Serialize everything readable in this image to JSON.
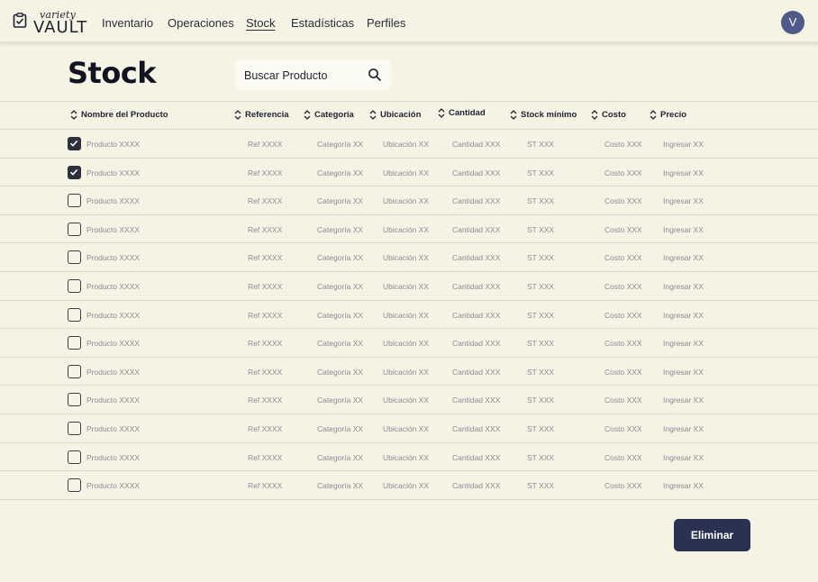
{
  "brand": {
    "small": "variety",
    "big": "VAULT"
  },
  "nav": [
    "Inventario",
    "Operaciones",
    "Stock",
    "Estadísticas",
    "Perfiles"
  ],
  "nav_active": "Stock",
  "user": {
    "initial": "V",
    "avatar_color": "#4f5a8a"
  },
  "page": {
    "title": "Stock"
  },
  "search": {
    "placeholder": "Buscar Producto"
  },
  "table": {
    "columns": [
      "Nombre del Producto",
      "Referencia",
      "Categoría",
      "Ubicación",
      "Cantidad",
      "Stock mínimo",
      "Costo",
      "Precio"
    ],
    "row_template": [
      "Producto XXXX",
      "Ref XXXX",
      "Categoría XX",
      "Ubicación XX",
      "Cantidad XXX",
      "ST XXX",
      "Costo XXX",
      "Ingresar XX"
    ],
    "checked": [
      true,
      true,
      false,
      false,
      false,
      false,
      false,
      false,
      false,
      false,
      false,
      false,
      false
    ]
  },
  "actions": {
    "delete_label": "Eliminar"
  },
  "colors": {
    "background": "#f5f3e4",
    "primary": "#2b3150",
    "muted_text": "#8a8c95"
  }
}
